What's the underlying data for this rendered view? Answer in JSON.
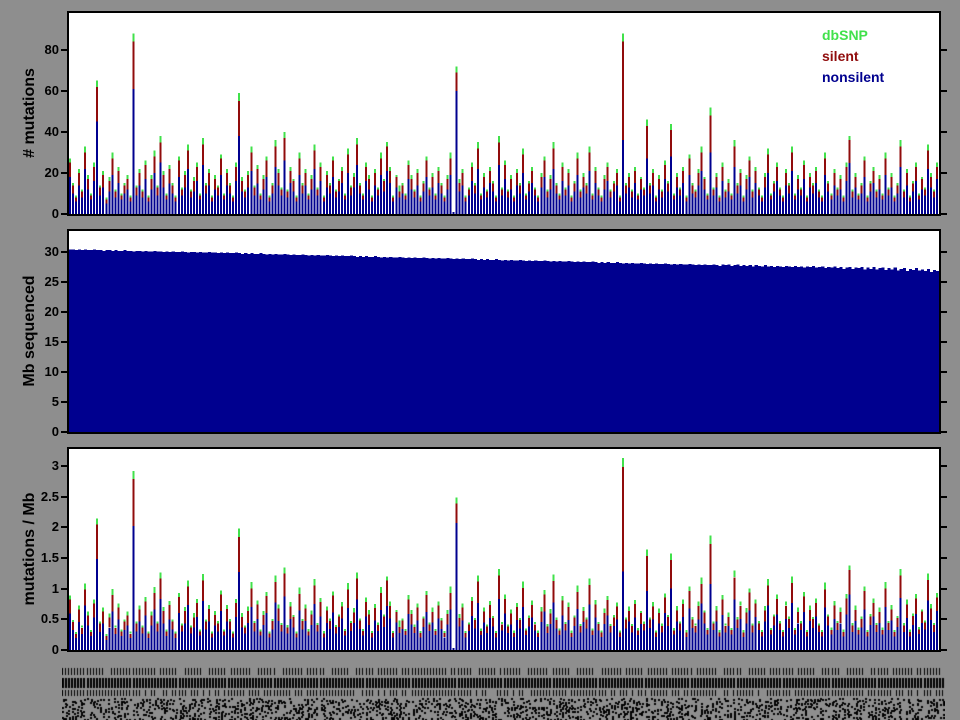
{
  "colors": {
    "background": "#8e8e8e",
    "panel_bg": "#ffffff",
    "frame": "#000000",
    "dbsnp": "#41e14b",
    "silent": "#900c0c",
    "nonsilent": "#00008f"
  },
  "legend": {
    "items": [
      {
        "label": "dbSNP",
        "color_key": "dbsnp"
      },
      {
        "label": "silent",
        "color_key": "silent"
      },
      {
        "label": "nonsilent",
        "color_key": "nonsilent"
      }
    ]
  },
  "x_axis": {
    "n_samples": 288,
    "labels_note": "per-sample tick labels rendered vertically; illegible at source resolution"
  },
  "chart_data": [
    {
      "type": "stacked-bar",
      "ylabel": "# mutations",
      "ylim": [
        0,
        98
      ],
      "yticks": [
        0,
        20,
        40,
        60,
        80
      ],
      "grid": false,
      "legend_position": "top-right-inside",
      "series": [
        {
          "name": "nonsilent",
          "color_key": "nonsilent",
          "values_key": "nonsilent"
        },
        {
          "name": "silent",
          "color_key": "silent",
          "values_key": "silent"
        },
        {
          "name": "dbSNP",
          "color_key": "dbsnp",
          "values_key": "dbsnp"
        }
      ]
    },
    {
      "type": "bar",
      "ylabel": "Mb sequenced",
      "ylim": [
        0,
        33.5
      ],
      "yticks": [
        0,
        5,
        10,
        15,
        20,
        25,
        30
      ],
      "grid": false,
      "series": [
        {
          "name": "Mb sequenced",
          "color_key": "nonsilent",
          "values_key": "mb"
        }
      ]
    },
    {
      "type": "stacked-bar",
      "ylabel": "mutations / Mb",
      "ylim": [
        0,
        3.28
      ],
      "yticks": [
        0,
        0.5,
        1,
        1.5,
        2,
        2.5,
        3
      ],
      "grid": false,
      "per_mb": true,
      "derived": "values of chart 1 divided per-sample by mb",
      "series": [
        {
          "name": "nonsilent",
          "color_key": "nonsilent",
          "values_key": "nonsilent"
        },
        {
          "name": "silent",
          "color_key": "silent",
          "values_key": "silent"
        },
        {
          "name": "dbSNP",
          "color_key": "dbsnp",
          "values_key": "dbsnp"
        }
      ]
    }
  ],
  "values": {
    "nonsilent": [
      18,
      10,
      6,
      14,
      8,
      22,
      12,
      7,
      16,
      45,
      9,
      13,
      5,
      11,
      19,
      8,
      15,
      7,
      10,
      12,
      6,
      61,
      9,
      14,
      8,
      17,
      6,
      12,
      20,
      9,
      25,
      13,
      7,
      15,
      10,
      6,
      18,
      9,
      13,
      22,
      8,
      11,
      16,
      7,
      24,
      10,
      14,
      6,
      12,
      9,
      19,
      7,
      14,
      10,
      6,
      16,
      38,
      11,
      8,
      13,
      21,
      9,
      15,
      7,
      12,
      18,
      6,
      10,
      23,
      14,
      9,
      26,
      8,
      15,
      11,
      6,
      19,
      10,
      14,
      7,
      12,
      22,
      9,
      16,
      6,
      13,
      10,
      18,
      8,
      11,
      15,
      7,
      20,
      9,
      13,
      24,
      10,
      7,
      16,
      12,
      6,
      14,
      9,
      19,
      11,
      21,
      15,
      6,
      13,
      8,
      10,
      7,
      17,
      12,
      8,
      14,
      6,
      11,
      18,
      9,
      13,
      7,
      15,
      10,
      6,
      12,
      19,
      1,
      60,
      11,
      14,
      6,
      9,
      16,
      10,
      22,
      7,
      13,
      8,
      15,
      11,
      6,
      24,
      9,
      17,
      8,
      12,
      6,
      14,
      10,
      20,
      7,
      11,
      15,
      9,
      6,
      13,
      18,
      8,
      12,
      22,
      10,
      7,
      16,
      9,
      14,
      6,
      11,
      19,
      8,
      13,
      10,
      21,
      7,
      15,
      9,
      6,
      12,
      16,
      8,
      11,
      14,
      6,
      36,
      10,
      13,
      8,
      15,
      7,
      12,
      9,
      27,
      10,
      14,
      6,
      12,
      8,
      17,
      11,
      28,
      7,
      13,
      9,
      15,
      6,
      19,
      10,
      8,
      14,
      21,
      12,
      7,
      30,
      9,
      13,
      6,
      16,
      8,
      11,
      7,
      23,
      10,
      14,
      6,
      12,
      18,
      8,
      15,
      9,
      6,
      13,
      20,
      7,
      11,
      16,
      9,
      6,
      14,
      10,
      21,
      7,
      12,
      9,
      17,
      6,
      13,
      10,
      15,
      8,
      6,
      19,
      11,
      7,
      14,
      9,
      12,
      6,
      16,
      25,
      8,
      13,
      7,
      10,
      18,
      6,
      11,
      15,
      8,
      12,
      7,
      19,
      9,
      13,
      6,
      10,
      23,
      8,
      14,
      6,
      11,
      16,
      7,
      12,
      9,
      22,
      13,
      8,
      17
    ],
    "silent": [
      7,
      4,
      2,
      6,
      3,
      8,
      5,
      2,
      7,
      17,
      4,
      6,
      2,
      5,
      8,
      3,
      6,
      2,
      4,
      5,
      2,
      23,
      4,
      6,
      3,
      7,
      2,
      5,
      8,
      4,
      10,
      6,
      2,
      7,
      4,
      2,
      8,
      3,
      6,
      9,
      3,
      5,
      7,
      2,
      10,
      4,
      6,
      2,
      5,
      4,
      8,
      2,
      6,
      4,
      2,
      7,
      17,
      5,
      3,
      6,
      9,
      4,
      7,
      2,
      5,
      8,
      2,
      4,
      10,
      6,
      3,
      11,
      3,
      6,
      5,
      2,
      8,
      4,
      6,
      2,
      5,
      9,
      3,
      7,
      2,
      6,
      4,
      8,
      3,
      5,
      6,
      2,
      9,
      4,
      5,
      10,
      4,
      2,
      7,
      5,
      2,
      6,
      3,
      8,
      5,
      12,
      6,
      2,
      5,
      3,
      4,
      2,
      7,
      5,
      3,
      6,
      2,
      4,
      8,
      3,
      5,
      2,
      6,
      4,
      2,
      5,
      8,
      0,
      9,
      4,
      6,
      2,
      3,
      7,
      4,
      10,
      2,
      5,
      3,
      6,
      4,
      2,
      11,
      3,
      7,
      3,
      5,
      2,
      6,
      4,
      9,
      2,
      4,
      6,
      3,
      2,
      5,
      8,
      3,
      5,
      10,
      4,
      2,
      7,
      3,
      6,
      2,
      4,
      8,
      3,
      5,
      4,
      9,
      2,
      6,
      3,
      2,
      5,
      7,
      3,
      4,
      6,
      2,
      48,
      4,
      5,
      3,
      6,
      2,
      5,
      3,
      16,
      4,
      6,
      2,
      5,
      3,
      7,
      4,
      13,
      2,
      5,
      3,
      6,
      2,
      8,
      4,
      3,
      6,
      9,
      5,
      2,
      18,
      3,
      5,
      2,
      7,
      3,
      4,
      2,
      10,
      4,
      6,
      2,
      5,
      8,
      3,
      6,
      3,
      2,
      5,
      9,
      2,
      4,
      7,
      3,
      2,
      6,
      4,
      9,
      2,
      5,
      3,
      7,
      2,
      5,
      4,
      6,
      3,
      2,
      8,
      4,
      2,
      6,
      3,
      5,
      2,
      7,
      11,
      3,
      5,
      2,
      4,
      8,
      2,
      4,
      6,
      3,
      5,
      2,
      8,
      3,
      5,
      2,
      4,
      10,
      3,
      6,
      2,
      4,
      7,
      2,
      5,
      3,
      9,
      5,
      3,
      6
    ],
    "dbsnp": [
      2,
      1,
      1,
      2,
      1,
      3,
      2,
      1,
      2,
      3,
      1,
      2,
      1,
      2,
      3,
      1,
      2,
      1,
      1,
      2,
      1,
      4,
      1,
      2,
      1,
      2,
      1,
      2,
      3,
      1,
      3,
      2,
      1,
      2,
      1,
      1,
      2,
      1,
      2,
      3,
      1,
      2,
      2,
      1,
      3,
      1,
      2,
      1,
      2,
      1,
      2,
      1,
      2,
      1,
      1,
      2,
      4,
      2,
      1,
      2,
      3,
      1,
      2,
      1,
      2,
      2,
      1,
      1,
      3,
      2,
      1,
      3,
      1,
      2,
      1,
      1,
      3,
      1,
      2,
      1,
      2,
      3,
      1,
      2,
      1,
      2,
      1,
      2,
      1,
      1,
      2,
      1,
      3,
      1,
      2,
      3,
      1,
      1,
      2,
      2,
      1,
      2,
      1,
      3,
      1,
      2,
      2,
      1,
      1,
      3,
      1,
      1,
      2,
      2,
      1,
      2,
      1,
      1,
      2,
      1,
      2,
      1,
      2,
      1,
      1,
      2,
      3,
      0,
      3,
      2,
      2,
      1,
      1,
      2,
      1,
      3,
      1,
      2,
      1,
      2,
      1,
      1,
      3,
      1,
      2,
      1,
      2,
      1,
      2,
      1,
      3,
      1,
      1,
      2,
      1,
      1,
      2,
      2,
      1,
      2,
      3,
      1,
      1,
      2,
      1,
      2,
      1,
      1,
      3,
      1,
      2,
      1,
      3,
      1,
      2,
      1,
      1,
      2,
      2,
      1,
      1,
      2,
      1,
      4,
      1,
      2,
      1,
      2,
      1,
      1,
      1,
      3,
      1,
      2,
      1,
      2,
      1,
      2,
      1,
      3,
      1,
      2,
      1,
      2,
      1,
      2,
      1,
      1,
      2,
      3,
      1,
      1,
      4,
      1,
      2,
      1,
      2,
      1,
      2,
      1,
      3,
      1,
      2,
      1,
      2,
      2,
      1,
      2,
      1,
      1,
      2,
      3,
      1,
      1,
      2,
      1,
      1,
      2,
      1,
      3,
      1,
      2,
      1,
      2,
      1,
      2,
      1,
      2,
      1,
      1,
      3,
      1,
      1,
      2,
      1,
      2,
      1,
      2,
      2,
      1,
      2,
      1,
      1,
      2,
      1,
      1,
      2,
      1,
      2,
      1,
      3,
      1,
      2,
      1,
      1,
      3,
      1,
      2,
      1,
      1,
      2,
      1,
      1,
      1,
      3,
      2,
      1,
      2
    ],
    "mb": [
      30.4,
      30.4,
      30.3,
      30.4,
      30.3,
      30.4,
      30.3,
      30.3,
      30.4,
      30.3,
      30.3,
      30.2,
      30.3,
      30.3,
      30.2,
      30.3,
      30.2,
      30.2,
      30.3,
      30.2,
      30.2,
      30.1,
      30.2,
      30.2,
      30.1,
      30.2,
      30.1,
      30.1,
      30.2,
      30.1,
      30.1,
      30.0,
      30.1,
      30.0,
      30.1,
      30.0,
      30.0,
      30.1,
      30.0,
      29.9,
      30.0,
      30.0,
      29.9,
      30.0,
      29.9,
      29.9,
      30.0,
      29.9,
      29.9,
      29.8,
      29.9,
      29.8,
      29.9,
      29.8,
      29.8,
      29.9,
      29.8,
      29.7,
      29.8,
      29.7,
      29.8,
      29.7,
      29.7,
      29.8,
      29.7,
      29.6,
      29.7,
      29.6,
      29.7,
      29.6,
      29.6,
      29.7,
      29.6,
      29.5,
      29.6,
      29.5,
      29.5,
      29.6,
      29.5,
      29.4,
      29.5,
      29.4,
      29.5,
      29.4,
      29.4,
      29.5,
      29.4,
      29.3,
      29.4,
      29.3,
      29.4,
      29.3,
      29.3,
      29.4,
      29.3,
      29.2,
      29.3,
      29.2,
      29.3,
      29.2,
      29.2,
      29.3,
      29.2,
      29.1,
      29.2,
      29.1,
      29.2,
      29.1,
      29.1,
      29.2,
      29.1,
      29.0,
      29.1,
      29.0,
      29.1,
      29.0,
      29.0,
      29.1,
      29.0,
      28.9,
      29.0,
      28.9,
      29.0,
      28.9,
      28.9,
      29.0,
      28.9,
      28.8,
      28.9,
      28.8,
      28.9,
      28.8,
      28.8,
      28.9,
      28.8,
      28.7,
      28.8,
      28.7,
      28.8,
      28.7,
      28.7,
      28.8,
      28.7,
      28.6,
      28.7,
      28.6,
      28.7,
      28.6,
      28.6,
      28.7,
      28.6,
      28.5,
      28.6,
      28.5,
      28.6,
      28.5,
      28.5,
      28.6,
      28.5,
      28.4,
      28.5,
      28.4,
      28.5,
      28.4,
      28.4,
      28.5,
      28.4,
      28.3,
      28.4,
      28.3,
      28.4,
      28.3,
      28.3,
      28.4,
      28.3,
      28.2,
      28.3,
      28.2,
      28.3,
      28.2,
      28.2,
      28.3,
      28.2,
      28.1,
      28.2,
      28.1,
      28.2,
      28.1,
      28.1,
      28.2,
      28.1,
      28.0,
      28.1,
      28.0,
      28.1,
      28.0,
      28.0,
      28.1,
      28.0,
      27.9,
      28.0,
      27.9,
      28.0,
      27.9,
      27.9,
      28.0,
      27.9,
      27.8,
      27.9,
      27.8,
      27.9,
      27.8,
      27.8,
      27.9,
      27.8,
      27.7,
      27.9,
      27.8,
      27.9,
      27.7,
      27.8,
      27.9,
      27.7,
      27.8,
      27.7,
      27.8,
      27.6,
      27.8,
      27.7,
      27.6,
      27.8,
      27.6,
      27.7,
      27.5,
      27.7,
      27.6,
      27.5,
      27.7,
      27.6,
      27.5,
      27.7,
      27.5,
      27.6,
      27.4,
      27.6,
      27.5,
      27.7,
      27.4,
      27.5,
      27.6,
      27.3,
      27.5,
      27.4,
      27.6,
      27.3,
      27.5,
      27.2,
      27.4,
      27.5,
      27.2,
      27.4,
      27.3,
      27.5,
      27.1,
      27.4,
      27.2,
      27.5,
      27.1,
      27.3,
      27.4,
      27.0,
      27.3,
      27.1,
      27.4,
      26.9,
      27.2,
      27.3,
      26.8,
      27.2,
      27.0,
      27.3,
      26.9,
      27.1,
      26.8,
      27.2,
      26.7,
      27.0,
      26.8
    ]
  }
}
